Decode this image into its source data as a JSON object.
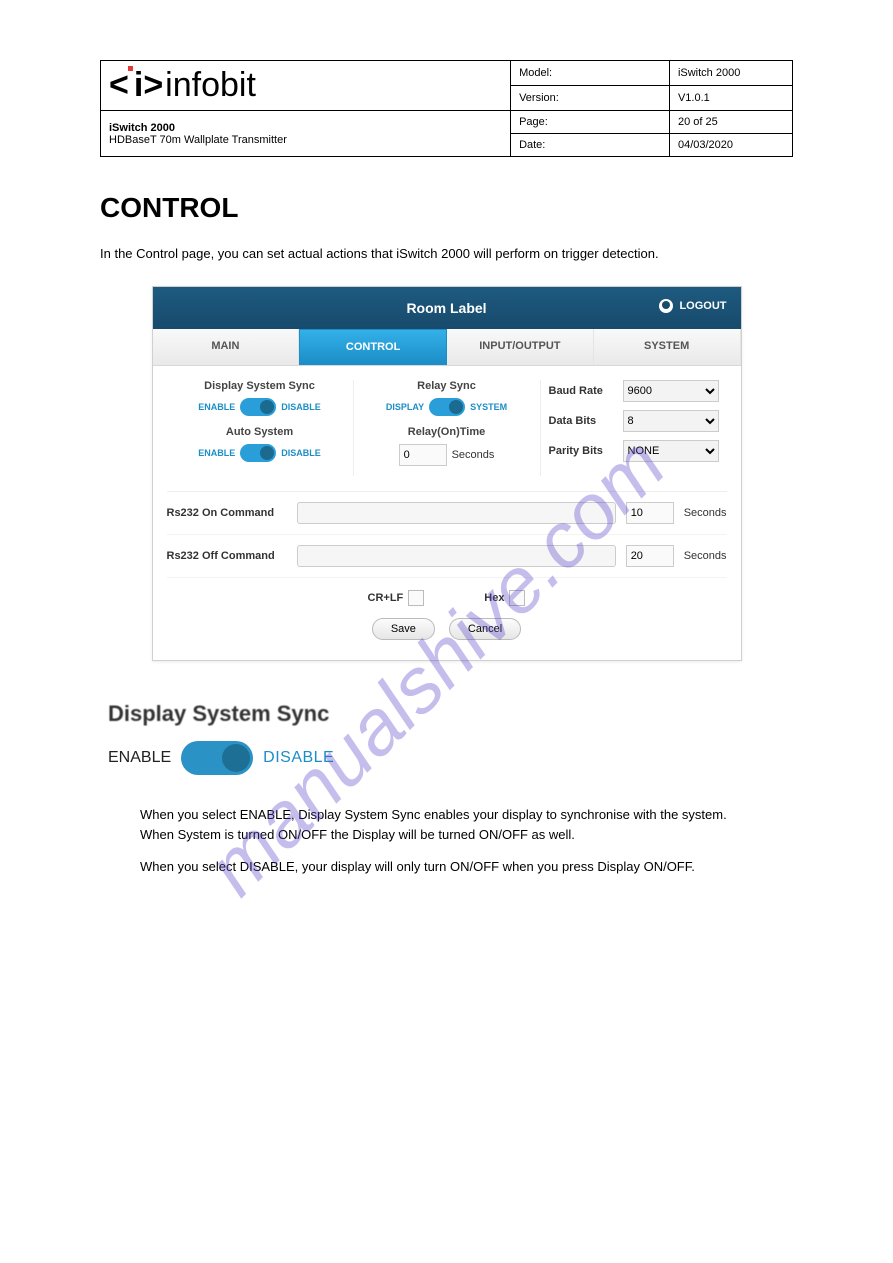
{
  "doc_table": {
    "model_label": "Model:",
    "model_value": "iSwitch 2000",
    "version_label": "Version:",
    "version_value": "V1.0.1",
    "product_line1": "iSwitch 2000",
    "product_line2": "HDBaseT 70m Wallplate Transmitter",
    "page_label": "Page:",
    "page_value": "20 of 25",
    "date_label": "Date:",
    "date_value": "04/03/2020"
  },
  "section": {
    "title": "CONTROL",
    "intro": "In the Control page, you can set actual actions that iSwitch 2000 will perform on trigger detection."
  },
  "webui": {
    "header_title": "Room Label",
    "logout": "LOGOUT",
    "tabs": [
      "MAIN",
      "CONTROL",
      "INPUT/OUTPUT",
      "SYSTEM"
    ],
    "active_tab": 1,
    "display_sync_title": "Display System Sync",
    "toggle_enable": "ENABLE",
    "toggle_disable": "DISABLE",
    "auto_system_title": "Auto System",
    "relay_sync_title": "Relay Sync",
    "relay_toggle_left": "DISPLAY",
    "relay_toggle_right": "SYSTEM",
    "relay_on_time_title": "Relay(On)Time",
    "relay_on_time_value": "0",
    "seconds_label": "Seconds",
    "baud_label": "Baud Rate",
    "baud_value": "9600",
    "data_bits_label": "Data Bits",
    "data_bits_value": "8",
    "parity_label": "Parity Bits",
    "parity_value": "NONE",
    "rs232_on_label": "Rs232 On Command",
    "rs232_on_seconds": "10",
    "rs232_off_label": "Rs232 Off Command",
    "rs232_off_seconds": "20",
    "crlf_label": "CR+LF",
    "hex_label": "Hex",
    "save_btn": "Save",
    "cancel_btn": "Cancel"
  },
  "zoom": {
    "title": "Display System Sync",
    "enable": "ENABLE",
    "disable": "DISABLE"
  },
  "explain": {
    "line1": "When you select ENABLE, Display System Sync enables your display to synchronise with the system. When System is turned ON/OFF the Display will be turned ON/OFF as well.",
    "line2": "When you select DISABLE, your display will only turn ON/OFF when you press Display ON/OFF."
  },
  "watermark_text": "manualshive.com"
}
